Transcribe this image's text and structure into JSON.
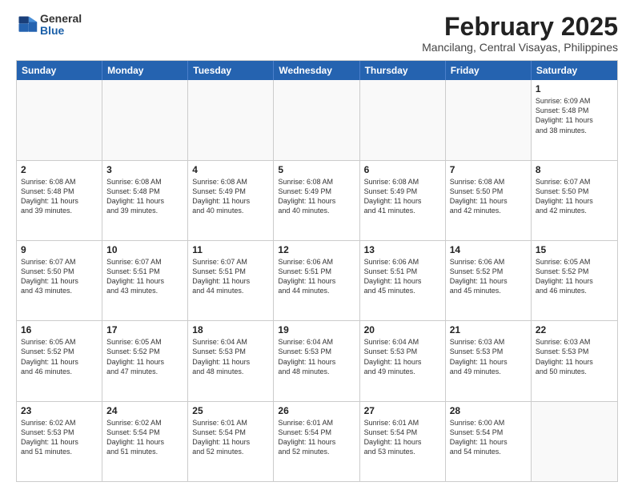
{
  "logo": {
    "general": "General",
    "blue": "Blue"
  },
  "title": "February 2025",
  "subtitle": "Mancilang, Central Visayas, Philippines",
  "days": [
    "Sunday",
    "Monday",
    "Tuesday",
    "Wednesday",
    "Thursday",
    "Friday",
    "Saturday"
  ],
  "weeks": [
    [
      {
        "day": "",
        "info": ""
      },
      {
        "day": "",
        "info": ""
      },
      {
        "day": "",
        "info": ""
      },
      {
        "day": "",
        "info": ""
      },
      {
        "day": "",
        "info": ""
      },
      {
        "day": "",
        "info": ""
      },
      {
        "day": "1",
        "info": "Sunrise: 6:09 AM\nSunset: 5:48 PM\nDaylight: 11 hours\nand 38 minutes."
      }
    ],
    [
      {
        "day": "2",
        "info": "Sunrise: 6:08 AM\nSunset: 5:48 PM\nDaylight: 11 hours\nand 39 minutes."
      },
      {
        "day": "3",
        "info": "Sunrise: 6:08 AM\nSunset: 5:48 PM\nDaylight: 11 hours\nand 39 minutes."
      },
      {
        "day": "4",
        "info": "Sunrise: 6:08 AM\nSunset: 5:49 PM\nDaylight: 11 hours\nand 40 minutes."
      },
      {
        "day": "5",
        "info": "Sunrise: 6:08 AM\nSunset: 5:49 PM\nDaylight: 11 hours\nand 40 minutes."
      },
      {
        "day": "6",
        "info": "Sunrise: 6:08 AM\nSunset: 5:49 PM\nDaylight: 11 hours\nand 41 minutes."
      },
      {
        "day": "7",
        "info": "Sunrise: 6:08 AM\nSunset: 5:50 PM\nDaylight: 11 hours\nand 42 minutes."
      },
      {
        "day": "8",
        "info": "Sunrise: 6:07 AM\nSunset: 5:50 PM\nDaylight: 11 hours\nand 42 minutes."
      }
    ],
    [
      {
        "day": "9",
        "info": "Sunrise: 6:07 AM\nSunset: 5:50 PM\nDaylight: 11 hours\nand 43 minutes."
      },
      {
        "day": "10",
        "info": "Sunrise: 6:07 AM\nSunset: 5:51 PM\nDaylight: 11 hours\nand 43 minutes."
      },
      {
        "day": "11",
        "info": "Sunrise: 6:07 AM\nSunset: 5:51 PM\nDaylight: 11 hours\nand 44 minutes."
      },
      {
        "day": "12",
        "info": "Sunrise: 6:06 AM\nSunset: 5:51 PM\nDaylight: 11 hours\nand 44 minutes."
      },
      {
        "day": "13",
        "info": "Sunrise: 6:06 AM\nSunset: 5:51 PM\nDaylight: 11 hours\nand 45 minutes."
      },
      {
        "day": "14",
        "info": "Sunrise: 6:06 AM\nSunset: 5:52 PM\nDaylight: 11 hours\nand 45 minutes."
      },
      {
        "day": "15",
        "info": "Sunrise: 6:05 AM\nSunset: 5:52 PM\nDaylight: 11 hours\nand 46 minutes."
      }
    ],
    [
      {
        "day": "16",
        "info": "Sunrise: 6:05 AM\nSunset: 5:52 PM\nDaylight: 11 hours\nand 46 minutes."
      },
      {
        "day": "17",
        "info": "Sunrise: 6:05 AM\nSunset: 5:52 PM\nDaylight: 11 hours\nand 47 minutes."
      },
      {
        "day": "18",
        "info": "Sunrise: 6:04 AM\nSunset: 5:53 PM\nDaylight: 11 hours\nand 48 minutes."
      },
      {
        "day": "19",
        "info": "Sunrise: 6:04 AM\nSunset: 5:53 PM\nDaylight: 11 hours\nand 48 minutes."
      },
      {
        "day": "20",
        "info": "Sunrise: 6:04 AM\nSunset: 5:53 PM\nDaylight: 11 hours\nand 49 minutes."
      },
      {
        "day": "21",
        "info": "Sunrise: 6:03 AM\nSunset: 5:53 PM\nDaylight: 11 hours\nand 49 minutes."
      },
      {
        "day": "22",
        "info": "Sunrise: 6:03 AM\nSunset: 5:53 PM\nDaylight: 11 hours\nand 50 minutes."
      }
    ],
    [
      {
        "day": "23",
        "info": "Sunrise: 6:02 AM\nSunset: 5:53 PM\nDaylight: 11 hours\nand 51 minutes."
      },
      {
        "day": "24",
        "info": "Sunrise: 6:02 AM\nSunset: 5:54 PM\nDaylight: 11 hours\nand 51 minutes."
      },
      {
        "day": "25",
        "info": "Sunrise: 6:01 AM\nSunset: 5:54 PM\nDaylight: 11 hours\nand 52 minutes."
      },
      {
        "day": "26",
        "info": "Sunrise: 6:01 AM\nSunset: 5:54 PM\nDaylight: 11 hours\nand 52 minutes."
      },
      {
        "day": "27",
        "info": "Sunrise: 6:01 AM\nSunset: 5:54 PM\nDaylight: 11 hours\nand 53 minutes."
      },
      {
        "day": "28",
        "info": "Sunrise: 6:00 AM\nSunset: 5:54 PM\nDaylight: 11 hours\nand 54 minutes."
      },
      {
        "day": "",
        "info": ""
      }
    ]
  ]
}
